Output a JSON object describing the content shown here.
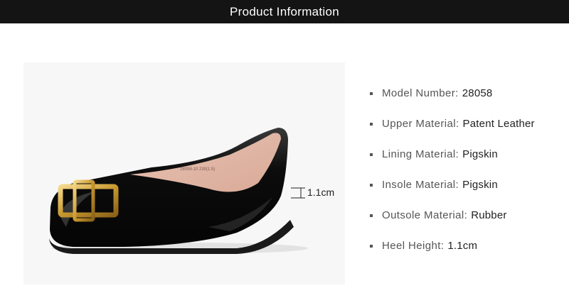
{
  "header": {
    "title": "Product Information"
  },
  "product_image": {
    "name": "black-patent-leather-flat-shoe",
    "insole_print": "28058-10 230(1.5)",
    "heel_annotation": "1.1cm"
  },
  "specs": [
    {
      "label": "Model Number:",
      "value": "28058"
    },
    {
      "label": "Upper Material:",
      "value": "Patent Leather"
    },
    {
      "label": "Lining Material:",
      "value": "Pigskin"
    },
    {
      "label": "Insole Material:",
      "value": "Pigskin"
    },
    {
      "label": "Outsole Material:",
      "value": "Rubber"
    },
    {
      "label": "Heel Height:",
      "value": "1.1cm"
    }
  ]
}
